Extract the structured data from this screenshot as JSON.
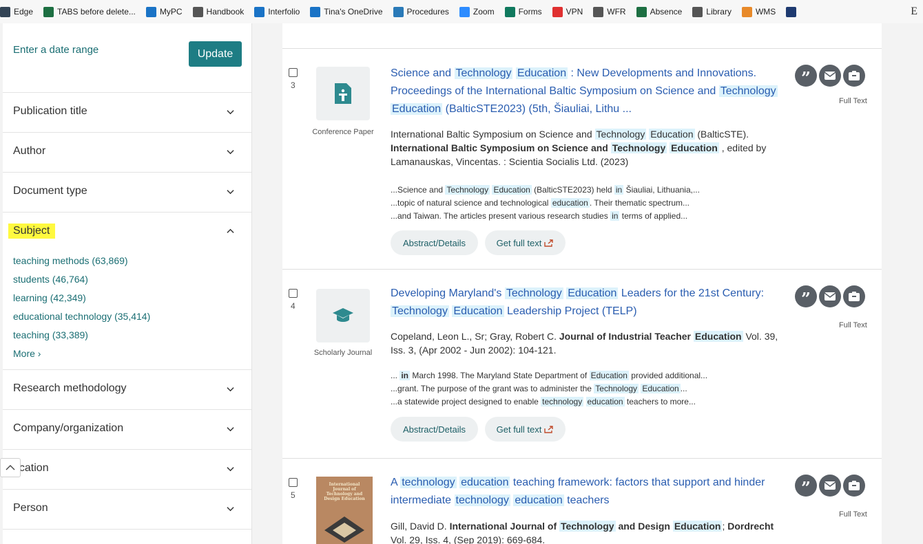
{
  "bookmarks": [
    {
      "label": "Edge",
      "icon": "edge-doc-icon",
      "color": "#345"
    },
    {
      "label": "TABS before delete...",
      "icon": "excel-icon",
      "color": "#1d6f42"
    },
    {
      "label": "MyPC",
      "icon": "cloud-icon",
      "color": "#1a73c6"
    },
    {
      "label": "Handbook",
      "icon": "document-icon",
      "color": "#555"
    },
    {
      "label": "Interfolio",
      "icon": "info-icon",
      "color": "#1a73c6"
    },
    {
      "label": "Tina's OneDrive",
      "icon": "cloud-icon",
      "color": "#1a73c6"
    },
    {
      "label": "Procedures",
      "icon": "flower-icon",
      "color": "#2a7ab8"
    },
    {
      "label": "Zoom",
      "icon": "zoom-icon",
      "color": "#2d8cff"
    },
    {
      "label": "Forms",
      "icon": "forms-icon",
      "color": "#10795e"
    },
    {
      "label": "VPN",
      "icon": "vpn-icon",
      "color": "#e03030"
    },
    {
      "label": "WFR",
      "icon": "page-icon",
      "color": "#555"
    },
    {
      "label": "Absence",
      "icon": "excel-icon",
      "color": "#1d6f42"
    },
    {
      "label": "Library",
      "icon": "document-icon",
      "color": "#555"
    },
    {
      "label": "WMS",
      "icon": "wms-icon",
      "color": "#e88a2a"
    },
    {
      "label": "",
      "icon": "e-icon",
      "color": "#1e3a70"
    }
  ],
  "bookmark_end": "E",
  "sidebar": {
    "date_range_link": "Enter a date range",
    "update_button": "Update",
    "facets_top": [
      "Publication title",
      "Author",
      "Document type"
    ],
    "subject": {
      "label": "Subject",
      "items": [
        "teaching methods (63,869)",
        "students (46,764)",
        "learning (42,349)",
        "educational technology (35,414)",
        "teaching (33,389)",
        "More ›"
      ]
    },
    "facets_bottom": [
      "Research methodology",
      "Company/organization",
      "  cation",
      "Person",
      ""
    ]
  },
  "results": [
    {
      "number": "3",
      "doc_type": "Conference Paper",
      "title_html": "Science and <span class=\"hl\">Technology</span> <span class=\"hl\">Education</span> : New Developments and Innovations. Proceedings of the International Baltic Symposium on Science and <span class=\"hl\">Technology</span> <span class=\"hl\">Education</span> (BalticSTE2023) (5th, Šiauliai, Lithu  ...",
      "byline_html": "International Baltic Symposium on Science and <span class=\"hl\">Technology</span> <span class=\"hl\">Education</span> (BalticSTE). <span class=\"b\">International Baltic Symposium on Science and <span class=\"hl\">Technology</span> <span class=\"hl\">Education</span></span> , edited by Lamanauskas, Vincentas. : Scientia Socialis Ltd. (2023)",
      "snippet_html": "...Science and <span class=\"hl\">Technology</span> <span class=\"hl\">Education</span> (BalticSTE2023) held <span class=\"hl\">in</span> Šiauliai, Lithuania,...<br>...topic of natural science and technological <span class=\"hl\">education</span>. Their thematic spectrum...<br>...and Taiwan. The articles present various research studies <span class=\"hl\">in</span> terms of applied...",
      "abstract_button": "Abstract/Details",
      "fulltext_button": "Get full text",
      "fulltext_label": "Full Text"
    },
    {
      "number": "4",
      "doc_type": "Scholarly Journal",
      "title_html": "Developing Maryland's <span class=\"hl\">Technology</span> <span class=\"hl\">Education</span> Leaders for the 21st Century: <span class=\"hl\">Technology</span> <span class=\"hl\">Education</span> Leadership Project (TELP)",
      "byline_html": "Copeland, Leon L., Sr; Gray, Robert C. <span class=\"b\">Journal of Industrial Teacher <span class=\"hl\">Education</span></span> Vol. 39, Iss. 3,  (Apr 2002 - Jun 2002): 104-121.",
      "snippet_html": "... <span class=\"hl b\">in</span> March 1998. The Maryland State Department of <span class=\"hl\">Education</span> provided additional...<br>...grant. The purpose of the grant was to administer the <span class=\"hl\">Technology</span> <span class=\"hl\">Education</span>...<br>...a statewide project designed to enable <span class=\"hl\">technology</span> <span class=\"hl\">education</span> teachers to more...",
      "abstract_button": "Abstract/Details",
      "fulltext_button": "Get full text",
      "fulltext_label": "Full Text"
    },
    {
      "number": "5",
      "cover_text": "International Journal of Technology and Design Education",
      "title_html": "A <span class=\"hl\">technology</span> <span class=\"hl\">education</span> teaching framework: factors that support and hinder intermediate <span class=\"hl\">technology</span> <span class=\"hl\">education</span> teachers",
      "byline_html": "Gill, David D. <span class=\"b\">International Journal of <span class=\"hl\">Technology</span> and Design <span class=\"hl\">Education</span></span>; <span class=\"b\">Dordrecht</span> Vol. 29, Iss. 4,  (Sep 2019): 669-684.",
      "fulltext_label": "Full Text"
    }
  ]
}
